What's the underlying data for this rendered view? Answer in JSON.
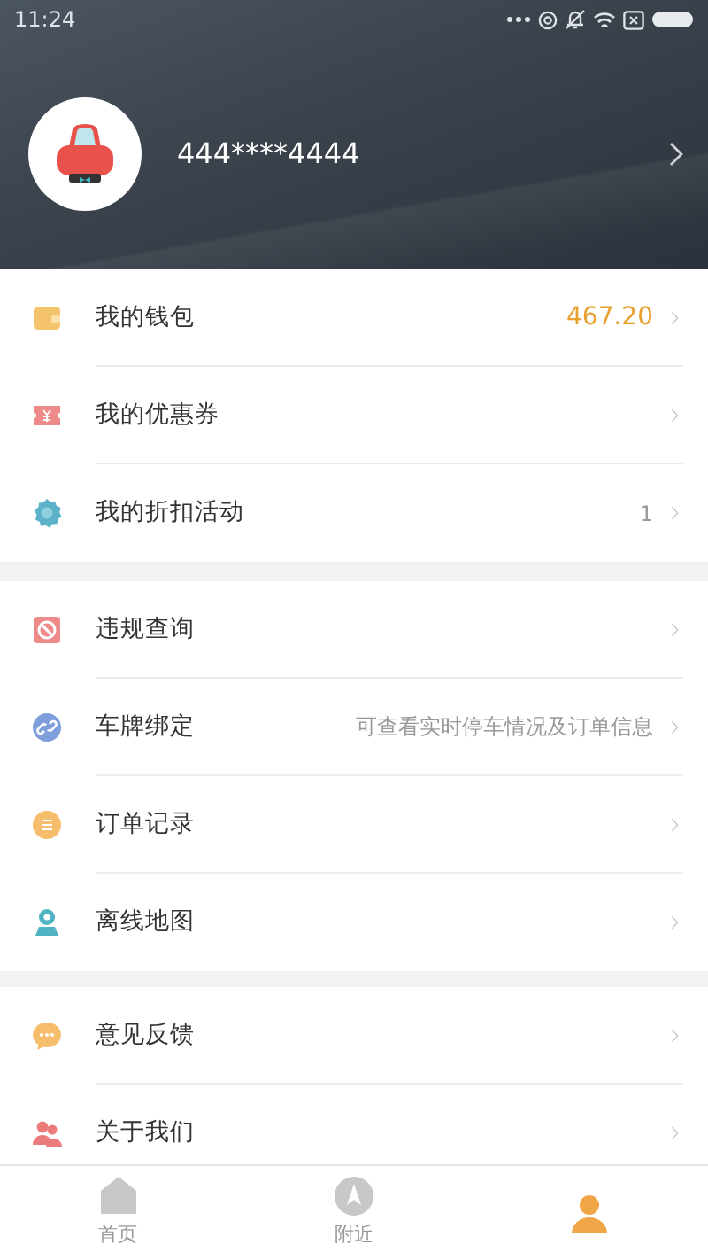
{
  "status_bar": {
    "time": "11:24"
  },
  "profile": {
    "phone": "444****4444"
  },
  "sections": [
    [
      {
        "kind": "wallet",
        "label": "我的钱包",
        "value": "467.20",
        "accent": true
      },
      {
        "kind": "coupon",
        "label": "我的优惠券"
      },
      {
        "kind": "discount",
        "label": "我的折扣活动",
        "value": "1",
        "accent": false
      }
    ],
    [
      {
        "kind": "violation",
        "label": "违规查询"
      },
      {
        "kind": "link",
        "label": "车牌绑定",
        "value": "可查看实时停车情况及订单信息",
        "accent": false
      },
      {
        "kind": "orders",
        "label": "订单记录"
      },
      {
        "kind": "map",
        "label": "离线地图"
      }
    ],
    [
      {
        "kind": "feedback",
        "label": "意见反馈"
      },
      {
        "kind": "about",
        "label": "关于我们"
      }
    ]
  ],
  "tabs": [
    {
      "kind": "home",
      "label": "首页",
      "selected": false
    },
    {
      "kind": "nearby",
      "label": "附近",
      "selected": false
    },
    {
      "kind": "me",
      "selected": true
    }
  ]
}
